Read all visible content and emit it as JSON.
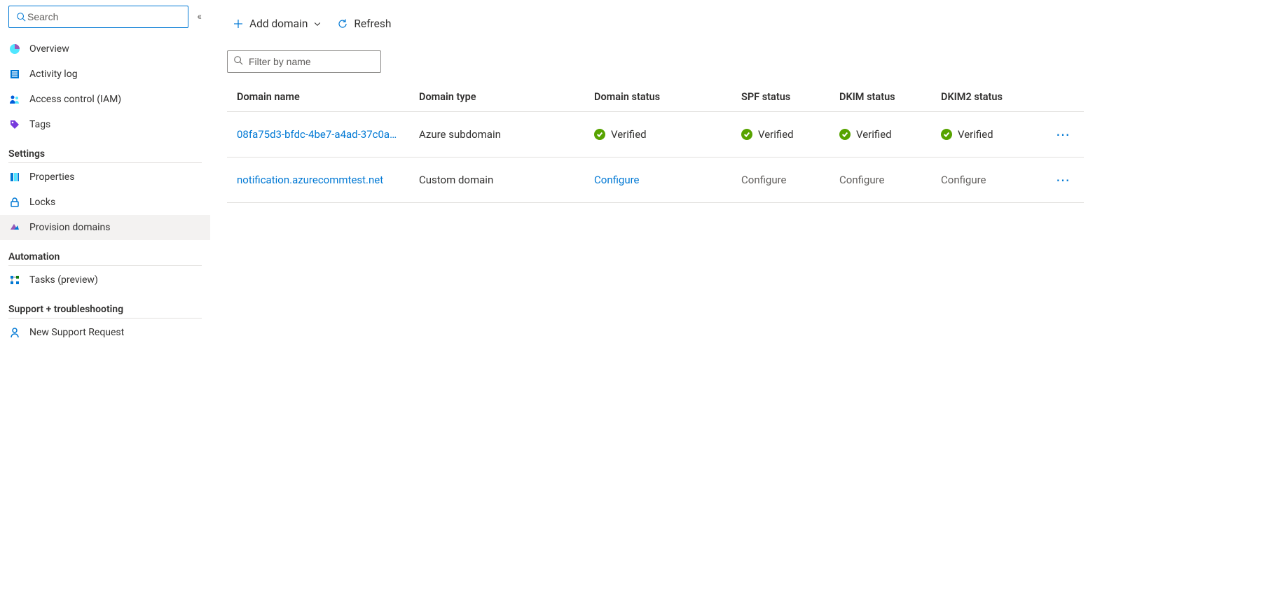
{
  "sidebar": {
    "search_placeholder": "Search",
    "groups": [
      {
        "title": "",
        "items": [
          {
            "label": "Overview",
            "icon": "overview"
          },
          {
            "label": "Activity log",
            "icon": "log"
          },
          {
            "label": "Access control (IAM)",
            "icon": "access"
          },
          {
            "label": "Tags",
            "icon": "tag"
          }
        ]
      },
      {
        "title": "Settings",
        "items": [
          {
            "label": "Properties",
            "icon": "props"
          },
          {
            "label": "Locks",
            "icon": "lock"
          },
          {
            "label": "Provision domains",
            "icon": "provision",
            "selected": true
          }
        ]
      },
      {
        "title": "Automation",
        "items": [
          {
            "label": "Tasks (preview)",
            "icon": "tasks"
          }
        ]
      },
      {
        "title": "Support + troubleshooting",
        "items": [
          {
            "label": "New Support Request",
            "icon": "support"
          }
        ]
      }
    ]
  },
  "toolbar": {
    "add_domain": "Add domain",
    "refresh": "Refresh"
  },
  "filter": {
    "placeholder": "Filter by name"
  },
  "table": {
    "columns": {
      "name": "Domain name",
      "type": "Domain type",
      "domain_status": "Domain status",
      "spf": "SPF status",
      "dkim": "DKIM status",
      "dkim2": "DKIM2 status"
    },
    "rows": [
      {
        "name": "08fa75d3-bfdc-4be7-a4ad-37c0a…",
        "type": "Azure subdomain",
        "domain_status": {
          "state": "verified",
          "label": "Verified"
        },
        "spf": {
          "state": "verified",
          "label": "Verified"
        },
        "dkim": {
          "state": "verified",
          "label": "Verified"
        },
        "dkim2": {
          "state": "verified",
          "label": "Verified"
        }
      },
      {
        "name": "notification.azurecommtest.net",
        "type": "Custom domain",
        "domain_status": {
          "state": "configure-link",
          "label": "Configure"
        },
        "spf": {
          "state": "configure",
          "label": "Configure"
        },
        "dkim": {
          "state": "configure",
          "label": "Configure"
        },
        "dkim2": {
          "state": "configure",
          "label": "Configure"
        }
      }
    ]
  }
}
